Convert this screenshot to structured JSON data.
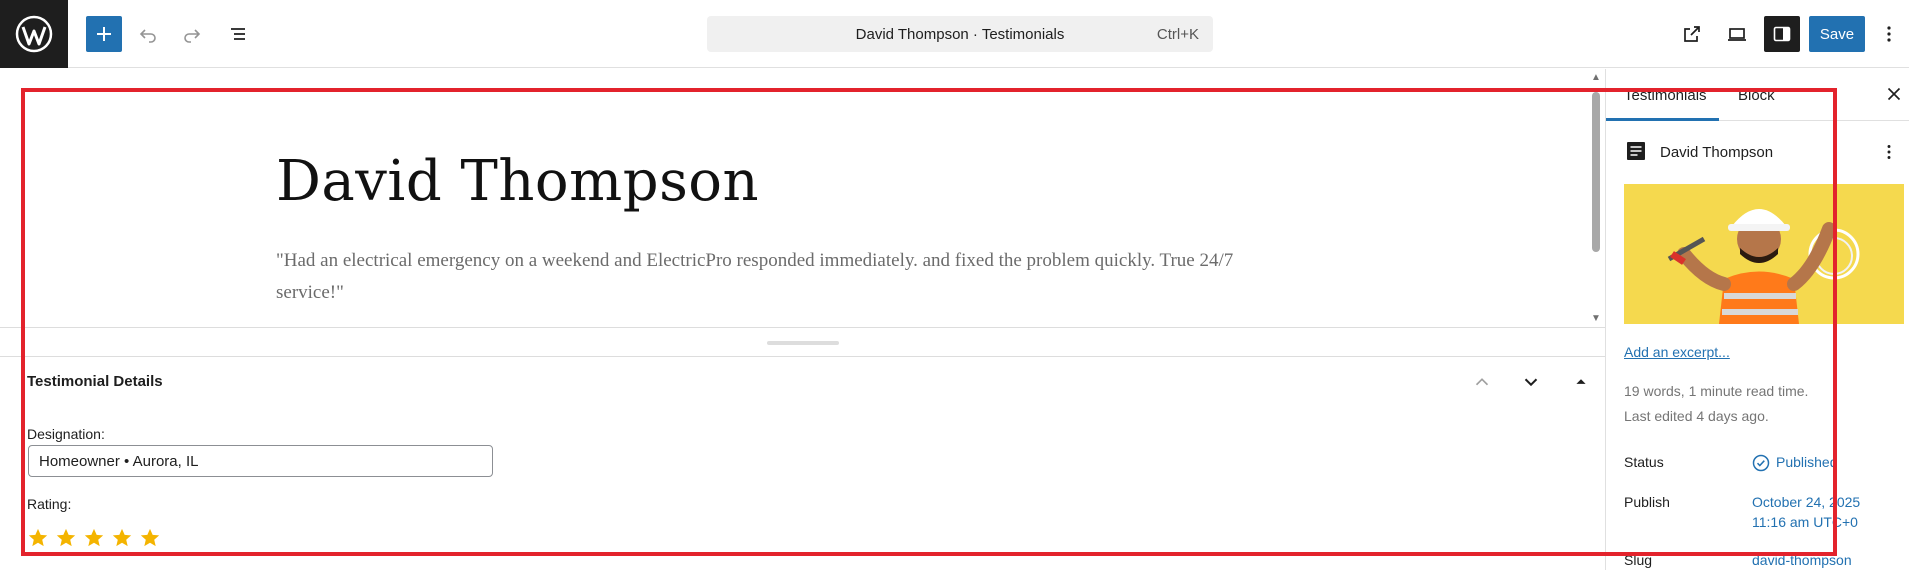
{
  "toolbar": {
    "document_title": "David Thompson · Testimonials",
    "shortcut": "Ctrl+K",
    "save_label": "Save"
  },
  "editor": {
    "post_title": "David Thompson",
    "post_content": "\"Had an electrical emergency on a weekend and ElectricPro responded immediately. and fixed the problem quickly. True 24/7 service!\""
  },
  "metabox": {
    "title": "Testimonial Details",
    "designation_label": "Designation:",
    "designation_value": "Homeowner • Aurora, IL",
    "rating_label": "Rating:",
    "rating": 5,
    "rating_max": 5
  },
  "sidebar": {
    "tabs": [
      "Testimonials",
      "Block"
    ],
    "active_tab": "Testimonials",
    "post_name": "David Thompson",
    "add_excerpt": "Add an excerpt...",
    "word_count": "19 words, 1 minute read time.",
    "last_edited": "Last edited 4 days ago.",
    "status_label": "Status",
    "status_value": "Published",
    "publish_label": "Publish",
    "publish_date": "October 24, 2025",
    "publish_time": "11:16 am UTC+0",
    "slug_label": "Slug",
    "slug_value": "david-thompson"
  },
  "colors": {
    "accent": "#2271b1",
    "highlight_frame": "#e3232c",
    "star": "#f4b400",
    "featured_bg": "#f5d94e"
  }
}
